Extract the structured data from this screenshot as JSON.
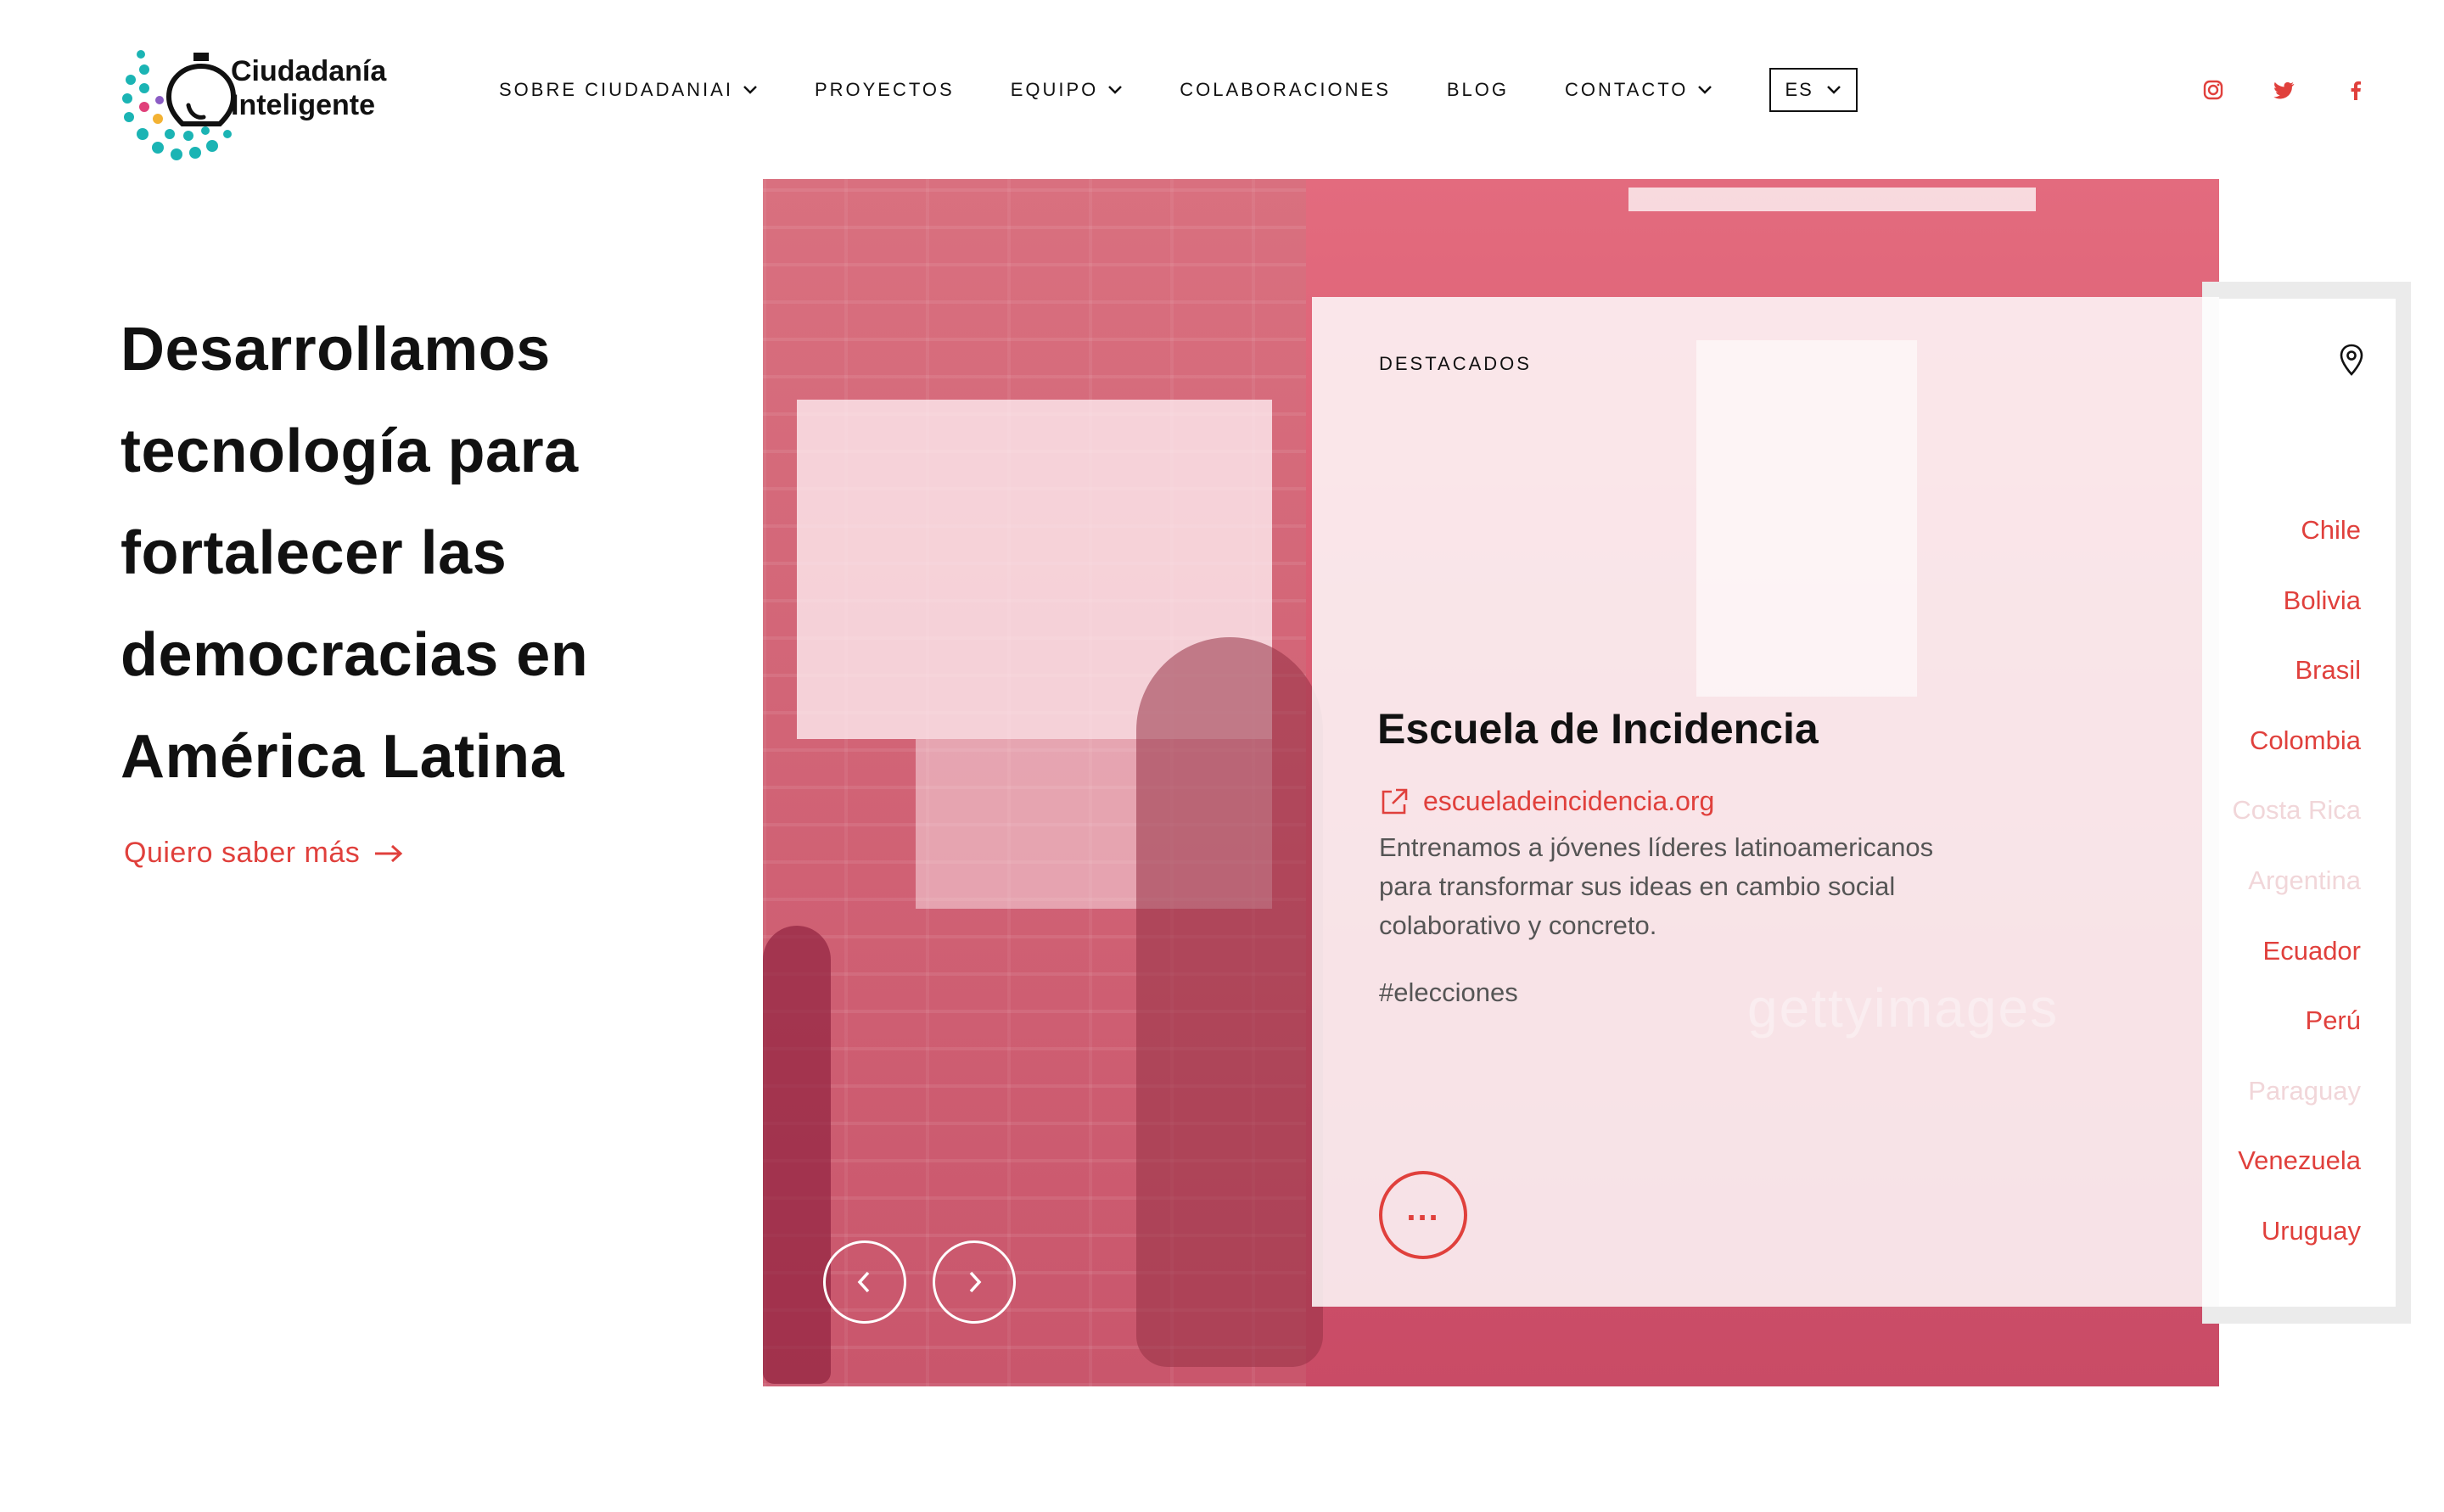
{
  "brand": {
    "name_line1": "Ciudadanía",
    "name_line2": "Inteligente",
    "colors": {
      "accent": "#e0403c",
      "teal": "#1bb4b4",
      "dark": "#111111",
      "muted_country": "#f1d6d9"
    }
  },
  "nav": {
    "items": [
      {
        "label": "SOBRE CIUDADANIAI",
        "has_dropdown": true
      },
      {
        "label": "PROYECTOS",
        "has_dropdown": false
      },
      {
        "label": "EQUIPO",
        "has_dropdown": true
      },
      {
        "label": "COLABORACIONES",
        "has_dropdown": false
      },
      {
        "label": "BLOG",
        "has_dropdown": false
      },
      {
        "label": "CONTACTO",
        "has_dropdown": true
      }
    ],
    "language": "ES"
  },
  "social": {
    "icons": [
      "instagram-icon",
      "twitter-icon",
      "facebook-icon"
    ]
  },
  "hero": {
    "title": "Desarrollamos tecnología para fortalecer las democracias en América Latina",
    "cta_label": "Quiero saber más"
  },
  "featured": {
    "section_label": "DESTACADOS",
    "title": "Escuela de Incidencia",
    "url_label": "escueladeincidencia.org",
    "description": "Entrenamos a jóvenes líderes latinoamericanos para transformar sus ideas en cambio social colaborativo y concreto.",
    "tag": "#elecciones",
    "more_label": "..."
  },
  "countries": [
    {
      "name": "Chile",
      "active": true
    },
    {
      "name": "Bolivia",
      "active": true
    },
    {
      "name": "Brasil",
      "active": true
    },
    {
      "name": "Colombia",
      "active": true
    },
    {
      "name": "Costa Rica",
      "active": false
    },
    {
      "name": "Argentina",
      "active": false
    },
    {
      "name": "Ecuador",
      "active": true
    },
    {
      "name": "Perú",
      "active": true
    },
    {
      "name": "Paraguay",
      "active": false
    },
    {
      "name": "Venezuela",
      "active": true
    },
    {
      "name": "Uruguay",
      "active": true
    }
  ],
  "photo": {
    "watermark": "gettyimages"
  }
}
